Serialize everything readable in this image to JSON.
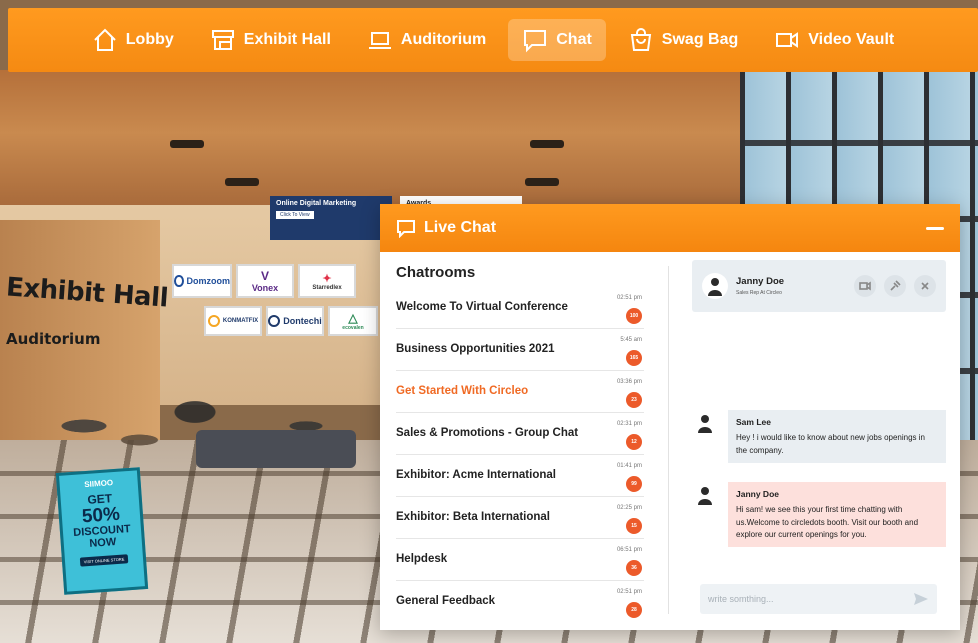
{
  "nav": {
    "items": [
      {
        "label": "Lobby",
        "icon": "home-icon"
      },
      {
        "label": "Exhibit Hall",
        "icon": "booth-icon"
      },
      {
        "label": "Auditorium",
        "icon": "laptop-icon"
      },
      {
        "label": "Chat",
        "icon": "chat-icon"
      },
      {
        "label": "Swag Bag",
        "icon": "bag-icon"
      },
      {
        "label": "Video Vault",
        "icon": "video-icon"
      }
    ],
    "active": "Chat",
    "accent": "#f58a12"
  },
  "scene": {
    "exhibit_sign": "Exhibit Hall",
    "auditorium_sign": "Auditorium",
    "banner1": {
      "title": "Online Digital Marketing",
      "cta": "Click To View"
    },
    "banner2": {
      "title": "Awards"
    },
    "logos": [
      "Domzoom",
      "Vonex",
      "Starredlex",
      "KONMATFIX",
      "Dontechi",
      "ecovalen"
    ],
    "promo": {
      "brand": "SIIMOO",
      "line1": "GET",
      "big": "50%",
      "line2": "DISCOUNT",
      "line3": "NOW",
      "button": "VISIT ONLINE STORE"
    }
  },
  "chat": {
    "title": "Live Chat",
    "rooms_title": "Chatrooms",
    "rooms": [
      {
        "name": "Welcome To Virtual Conference",
        "time": "02:51 pm",
        "count": "100"
      },
      {
        "name": "Business Opportunities 2021",
        "time": "5:45 am",
        "count": "165"
      },
      {
        "name": "Get Started With Circleo",
        "time": "03:36 pm",
        "count": "23"
      },
      {
        "name": "Sales & Promotions - Group Chat",
        "time": "02:31 pm",
        "count": "12"
      },
      {
        "name": "Exhibitor: Acme International",
        "time": "01:41 pm",
        "count": "99"
      },
      {
        "name": "Exhibitor: Beta International",
        "time": "02:25 pm",
        "count": "15"
      },
      {
        "name": "Helpdesk",
        "time": "06:51 pm",
        "count": "36"
      },
      {
        "name": "General Feedback",
        "time": "02:51 pm",
        "count": "28"
      }
    ],
    "active_room": "Get Started With Circleo",
    "contact": {
      "name": "Janny Doe",
      "role": "Sales Rep At Circleo"
    },
    "messages": [
      {
        "sender": "Sam Lee",
        "text": "Hey ! i would like to  know about new jobs openings in the company.",
        "style": "grey"
      },
      {
        "sender": "Janny Doe",
        "text": "Hi sam! we see this your first time chatting with us.Welcome to circledots booth. Visit our booth and explore our current openings for you.",
        "style": "pink"
      }
    ],
    "compose_placeholder": "write somthing..."
  }
}
